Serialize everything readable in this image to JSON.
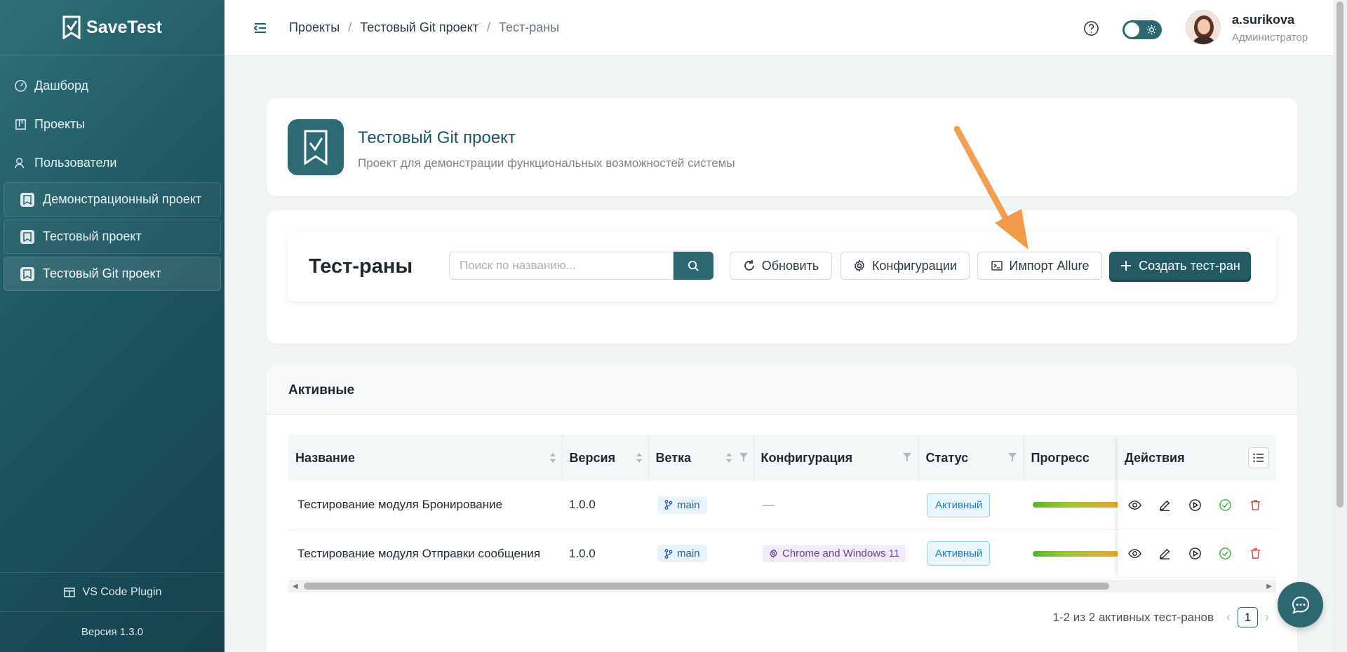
{
  "sidebar": {
    "app_name": "SaveTest",
    "nav": [
      {
        "label": "Дашборд",
        "icon": "dashboard-icon"
      },
      {
        "label": "Проекты",
        "icon": "projects-icon"
      },
      {
        "label": "Пользователи",
        "icon": "users-icon"
      }
    ],
    "projects": [
      {
        "label": "Демонстрационный проект",
        "active": false
      },
      {
        "label": "Тестовый проект",
        "active": false
      },
      {
        "label": "Тестовый Git проект",
        "active": true
      }
    ],
    "plugin_label": "VS Code Plugin",
    "version": "Версия 1.3.0"
  },
  "header": {
    "breadcrumb": [
      "Проекты",
      "Тестовый Git проект",
      "Тест-раны"
    ],
    "separator": "/",
    "user_name": "a.surikova",
    "user_role": "Администратор"
  },
  "project": {
    "title": "Тестовый Git проект",
    "description": "Проект для демонстрации функциональных возможностей системы"
  },
  "runs": {
    "title": "Тест-раны",
    "search_placeholder": "Поиск по названию...",
    "refresh_label": "Обновить",
    "config_label": "Конфигурации",
    "import_label": "Импорт Allure",
    "create_label": "Создать тест-ран"
  },
  "table": {
    "section_title": "Активные",
    "columns": [
      "Название",
      "Версия",
      "Ветка",
      "Конфигурация",
      "Статус",
      "Прогресс",
      "Действия"
    ],
    "rows": [
      {
        "name": "Тестирование модуля Бронирование",
        "version": "1.0.0",
        "branch": "main",
        "config": "—",
        "status": "Активный"
      },
      {
        "name": "Тестирование модуля Отправки сообщения",
        "version": "1.0.0",
        "branch": "main",
        "config": "Chrome and Windows 11",
        "status": "Активный"
      }
    ],
    "pagination_text": "1-2 из 2 активных тест-ранов",
    "page": "1"
  },
  "colors": {
    "primary": "#2d6770",
    "sidebar": "#1d5661",
    "status": "#1f7fc4",
    "delete": "#e5484d",
    "complete": "#3db53d",
    "annotation_arrow": "#f39a4a"
  }
}
